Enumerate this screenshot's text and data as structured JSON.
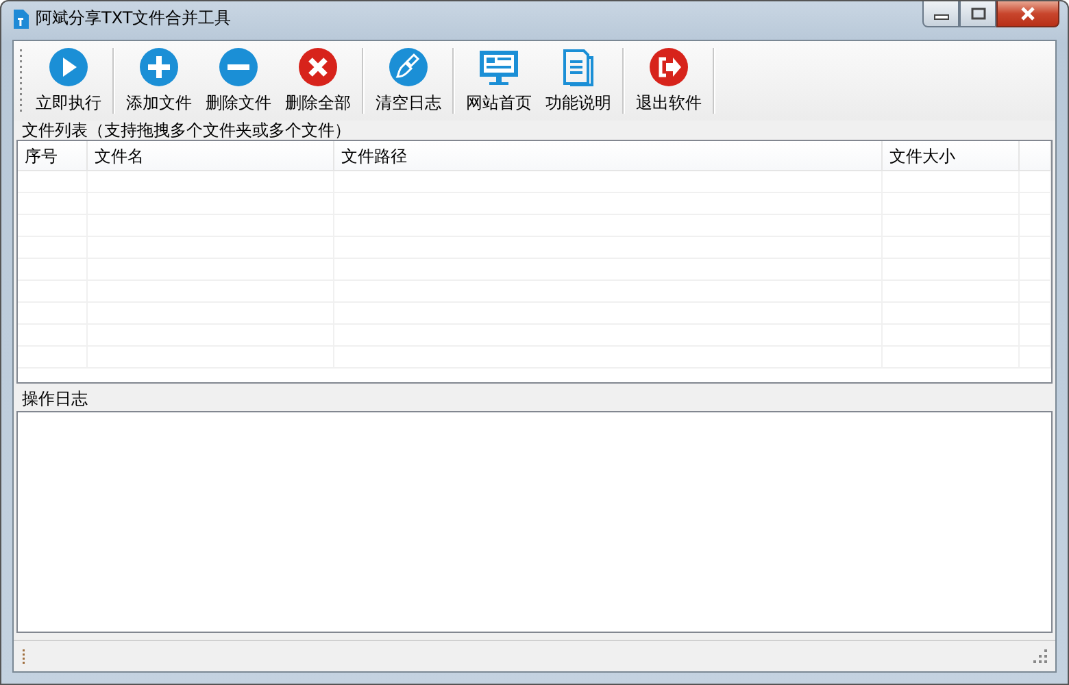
{
  "window": {
    "title": "阿斌分享TXT文件合并工具"
  },
  "toolbar": {
    "groups": [
      {
        "buttons": [
          {
            "label": "立即执行",
            "kind": "play"
          }
        ]
      },
      {
        "buttons": [
          {
            "label": "添加文件",
            "kind": "plus"
          },
          {
            "label": "删除文件",
            "kind": "minus"
          },
          {
            "label": "删除全部",
            "kind": "cross"
          }
        ]
      },
      {
        "buttons": [
          {
            "label": "清空日志",
            "kind": "brush"
          }
        ]
      },
      {
        "buttons": [
          {
            "label": "网站首页",
            "kind": "monitor"
          },
          {
            "label": "功能说明",
            "kind": "document"
          }
        ]
      },
      {
        "buttons": [
          {
            "label": "退出软件",
            "kind": "exit"
          }
        ]
      }
    ]
  },
  "file_list": {
    "title": "文件列表（支持拖拽多个文件夹或多个文件）",
    "columns": [
      "序号",
      "文件名",
      "文件路径",
      "文件大小"
    ]
  },
  "log": {
    "title": "操作日志"
  }
}
